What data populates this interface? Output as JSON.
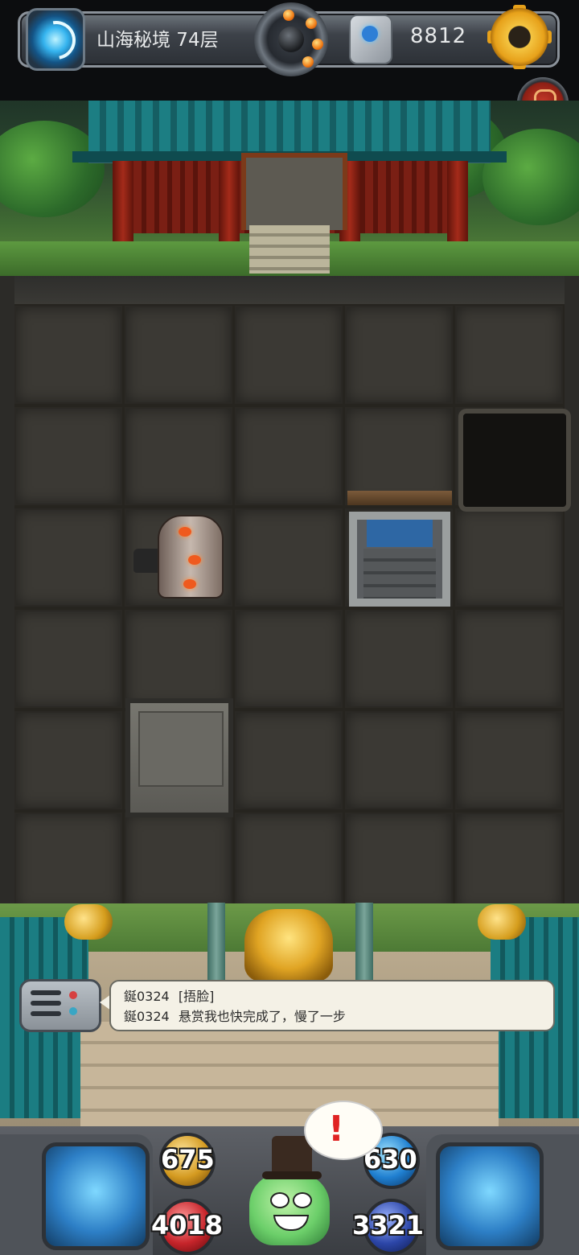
{
  "top_bar": {
    "level_label": "山海秘境 74层",
    "currency_amount": "8812"
  },
  "icons": {
    "portal": "portal-icon",
    "bomb_dial": "bomb-dial-icon",
    "rune_stone": "rune-stone-icon",
    "settings": "gear-icon",
    "side_button": "event-icon"
  },
  "chat": {
    "messages": [
      {
        "user": "鋋0324",
        "text": "[捂脸]"
      },
      {
        "user": "鋋0324",
        "text": "悬赏我也快完成了，慢了一步"
      }
    ]
  },
  "hud": {
    "attack": "675",
    "defense": "630",
    "hp": "4018",
    "mana": "3321",
    "alert_mark": "!"
  },
  "colors": {
    "accent_gold": "#e7a11a",
    "alert_red": "#e02323",
    "roof_teal": "#1c7e83"
  }
}
